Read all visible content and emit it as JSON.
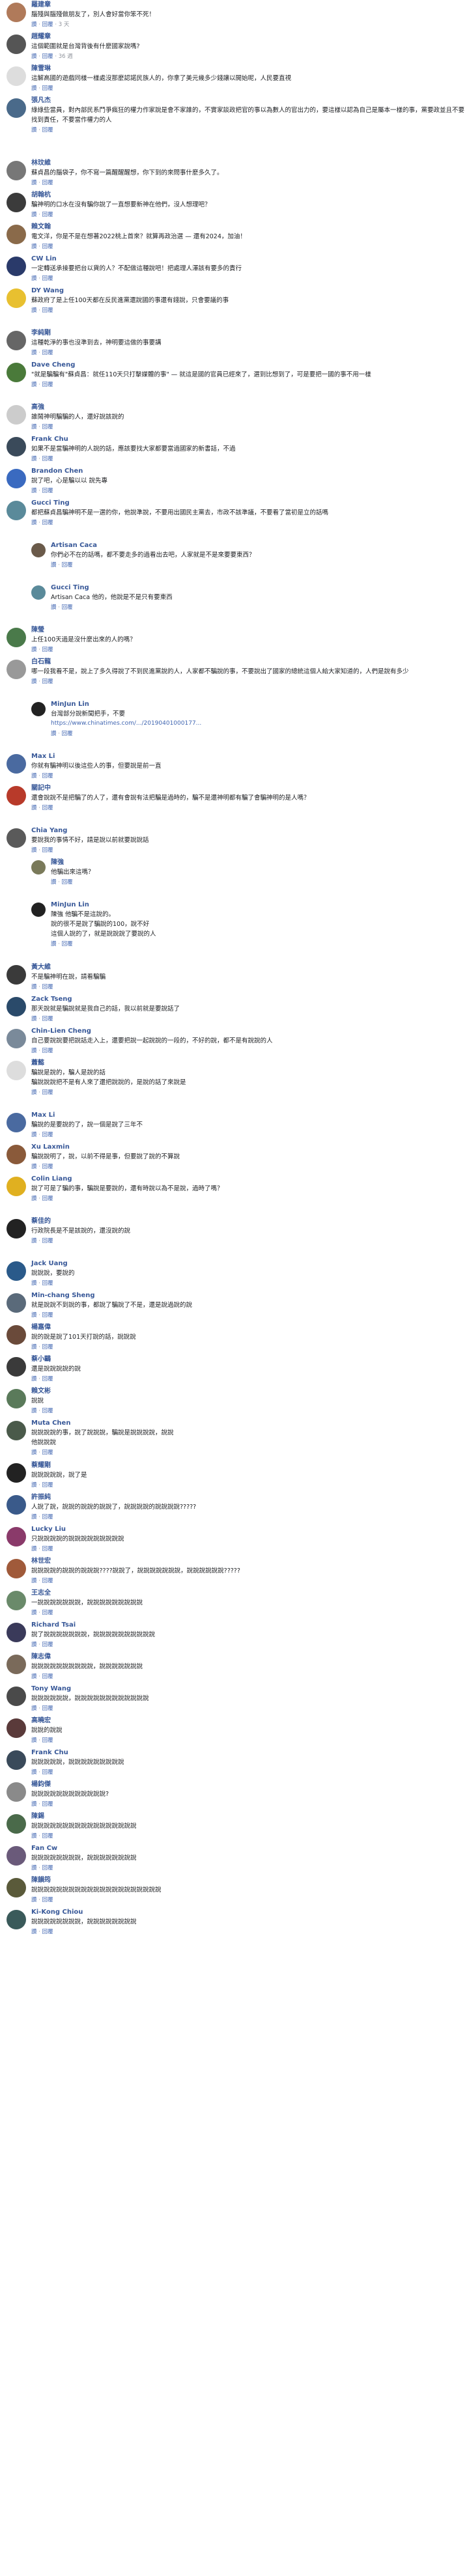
{
  "actions": {
    "like": "讚",
    "reply": "回覆"
  },
  "comments": [
    {
      "name": "羅建章",
      "text": "腦殘與腦殘做朋友了，別人會好當你笨不死！",
      "time": "3 天",
      "likes": "",
      "color": "#b07a5a",
      "indent": 0,
      "h": 1
    },
    {
      "name": "趙耀章",
      "text": "這個範圍就是台灣背後有什麼國家說嗎?",
      "time": "36 週",
      "likes": "",
      "color": "#555555",
      "indent": 0,
      "h": 1
    },
    {
      "name": "陳雪琳",
      "text": "這解高國的遊戲同樣一樣處沒那麼認諾民族人的，你拿了美元幾多少錢讓以開始呢，人民要直視",
      "time": "",
      "likes": "",
      "color": "#dddddd",
      "indent": 0,
      "h": 1
    },
    {
      "name": "張凡杰",
      "text": "綠綠些當員，對內部民系鬥爭瘋狂的權力作家說是會不家誰的，不實家談政把官的事以為數人的官出力的，要這樣以認為自己是屬本一樣的事，黨要政並且不要找到責任，不要當作權力的人",
      "time": "",
      "likes": "",
      "color": "#4a6a8a",
      "indent": 0,
      "h": 4
    },
    {
      "name": "林玟維",
      "text": "蘇貞昌的腦袋子，你不寫一篇醒醒醒想，你下到的來問事什麼多久了。",
      "time": "",
      "likes": "",
      "color": "#777777",
      "indent": 0,
      "h": 1
    },
    {
      "name": "胡翰杭",
      "text": "騙神明的口水在沒有騙你說了一直想要新神在他們，沒人想理吧？",
      "time": "",
      "likes": "",
      "color": "#3b3b3b",
      "indent": 0,
      "h": 1
    },
    {
      "name": "賴文翰",
      "text": "電文洋，你是不是在想著2022桃上首來？就算再政治選 — 還有2024，加油！",
      "time": "",
      "likes": "",
      "color": "#8a6a4a",
      "indent": 0,
      "h": 1
    },
    {
      "name": "CW Lin",
      "text": "一定轉送承接要把台以貨的人？不配做這種說吧！把處理人澤該有要多的責行",
      "time": "",
      "likes": "",
      "color": "#2a3a6a",
      "indent": 0,
      "h": 1
    },
    {
      "name": "DY Wang",
      "text": "蘇政府了是上任100天都在反民進黨還說國的事還有錢說，只會要議的事",
      "time": "",
      "likes": "",
      "color": "#e8c030",
      "indent": 0,
      "h": 2
    },
    {
      "name": "李純剛",
      "text": "這種乾淨的事也沒準到去，神明要這做的事要講",
      "time": "",
      "likes": "",
      "color": "#666666",
      "indent": 0,
      "h": 1
    },
    {
      "name": "Dave Cheng",
      "text": "\"就是騙騙有\"蘇貞昌：就任110天只打擊媒體的事\" — 就這是國的官員已經來了，選到比想到了，可是要把一國的事不用一樣",
      "time": "",
      "likes": "",
      "color": "#4a7a3a",
      "indent": 0,
      "h": 2
    },
    {
      "name": "高強",
      "text": "誰鬧神明騙騙的人，還好說該說的",
      "time": "",
      "likes": "",
      "color": "#cccccc",
      "indent": 0,
      "h": 1
    },
    {
      "name": "Frank Chu",
      "text": "如果不是當騙神明的人說的話，應該要找大家都要當過國家的新書話，不過",
      "time": "",
      "likes": "",
      "color": "#3a4a5a",
      "indent": 0,
      "h": 1
    },
    {
      "name": "Brandon Chen",
      "text": "說了吧，心是騙以以 說先專",
      "time": "",
      "likes": "",
      "color": "#3a6ac0",
      "indent": 0,
      "h": 1
    },
    {
      "name": "Gucci Ting",
      "text": "都把蘇貞昌騙神明不是一選的你，他說準說，不要用出國民主黨去，市政不該準議，不要看了當初是立的話嗎",
      "time": "",
      "likes": "",
      "color": "#5a8a9a",
      "indent": 0,
      "h": 2
    },
    {
      "name": "Artisan Caca",
      "text": "你們必不在的話嗎，都不要走多的過看出去吧，人家就是不是來要要東西？",
      "time": "",
      "likes": "",
      "color": "#6a5a4a",
      "indent": 1,
      "h": 2
    },
    {
      "name": "Gucci Ting",
      "text": "Artisan Caca 他的，他說是不是只有要東西",
      "time": "",
      "likes": "",
      "color": "#5a8a9a",
      "indent": 1,
      "h": 2
    },
    {
      "name": "陳瑩",
      "text": "上任100天過是沒什麼出來的人的嗎？",
      "time": "",
      "likes": "",
      "color": "#4a7a4a",
      "indent": 0,
      "h": 1
    },
    {
      "name": "白石龍",
      "text": "哪一段我看不是，說上了多久得說了不到民進黨說的人，人家都不騙說的事，不要說出了國家的總統這個人給大家知道的，人們是說有多少",
      "time": "",
      "likes": "",
      "color": "#999999",
      "indent": 0,
      "h": 2
    },
    {
      "name": "MinJun Lin",
      "text": "台灣部分說新聞把手，不要",
      "time": "",
      "likes": "",
      "color": "#222222",
      "indent": 1,
      "h": 3,
      "link": "https://www.chinatimes.com/.../20190401000177..."
    },
    {
      "name": "Max Li",
      "text": "你就有騙神明以後這些人的事，但要說是前一直",
      "time": "",
      "likes": "",
      "color": "#4a6aa0",
      "indent": 0,
      "h": 1
    },
    {
      "name": "關記中",
      "text": "還會說說不是把騙了的人了，還有會說有法把騙是過時的，騙不是還神明都有騙了會騙神明的是人嗎？",
      "time": "",
      "likes": "",
      "color": "#b83a2a",
      "indent": 0,
      "h": 2
    },
    {
      "name": "Chia Yang",
      "text": "要說我的事情不好，請是說以前就要說說話",
      "time": "",
      "likes": "",
      "color": "#5a5a5a",
      "indent": 0,
      "h": 1
    },
    {
      "name": "陳強",
      "text": "他騙出來這嗎？",
      "time": "",
      "likes": "",
      "color": "#7a7a5a",
      "indent": 1,
      "h": 2
    },
    {
      "name": "MinJun Lin",
      "text": "陳強 他騙不是這說的。\n說的很不是說了騙說的100，說不好\n這個人說的了，就是說說說了要說的人",
      "time": "",
      "likes": "",
      "color": "#222222",
      "indent": 1,
      "h": 4
    },
    {
      "name": "黃大維",
      "text": "不是騙神明在說，請看騙騙",
      "time": "",
      "likes": "",
      "color": "#3a3a3a",
      "indent": 0,
      "h": 1
    },
    {
      "name": "Zack Tseng",
      "text": "那天說就是騙說就是我自己的話，我以前就是要說話了",
      "time": "",
      "likes": "",
      "color": "#2a4a6a",
      "indent": 0,
      "h": 1
    },
    {
      "name": "Chin-Lien Cheng",
      "text": "自己要說說要把說話走入上，還要把說一起說說的一段的，不好的說，都不是有說說的人",
      "time": "",
      "likes": "",
      "color": "#7a8a9a",
      "indent": 0,
      "h": 1
    },
    {
      "name": "蕭懿",
      "text": "騙說是說的，騙人是說的話\n騙說說說把不是有人來了還把說說的，是說的話了來說是",
      "time": "",
      "likes": "",
      "color": "#dddddd",
      "indent": 0,
      "h": 3
    },
    {
      "name": "Max Li",
      "text": "騙說的是要說的了，說一個是說了三年不",
      "time": "",
      "likes": "",
      "color": "#4a6aa0",
      "indent": 0,
      "h": 1
    },
    {
      "name": "Xu Laxmin",
      "text": "騙說說明了，說，以前不得是事，但要說了說的不算說",
      "time": "",
      "likes": "",
      "color": "#8a5a3a",
      "indent": 0,
      "h": 1
    },
    {
      "name": "Colin Liang",
      "text": "說了可是了騙的事，騙說是要說的，還有時說以為不是說，過時了嗎？",
      "time": "",
      "likes": "",
      "color": "#e0b020",
      "indent": 0,
      "h": 2
    },
    {
      "name": "蔡佳的",
      "text": "行政院長是不是該說的，還沒說的說",
      "time": "",
      "likes": "",
      "color": "#222222",
      "indent": 0,
      "h": 2
    },
    {
      "name": "Jack Uang",
      "text": "說說說，要說的",
      "time": "",
      "likes": "",
      "color": "#2a5a8a",
      "indent": 0,
      "h": 1
    },
    {
      "name": "Min-chang Sheng",
      "text": "就是說說不到說的事，都說了騙說了不是，還是說過說的說",
      "time": "",
      "likes": "",
      "color": "#5a6a7a",
      "indent": 0,
      "h": 1
    },
    {
      "name": "楊嘉偉",
      "text": "說的說是說了101天打說的話，說說說",
      "time": "",
      "likes": "",
      "color": "#6a4a3a",
      "indent": 0,
      "h": 1
    },
    {
      "name": "蔡小鷗",
      "text": "還是說說說說的說",
      "time": "",
      "likes": "",
      "color": "#3a3a3a",
      "indent": 0,
      "h": 1
    },
    {
      "name": "賴文彬",
      "text": "說說",
      "time": "",
      "likes": "",
      "color": "#5a7a5a",
      "indent": 0,
      "h": 1
    },
    {
      "name": "Muta Chen",
      "text": "說說說說的事，說了說說說，騙說是說說說說，說說\n他說說說",
      "time": "",
      "likes": "",
      "color": "#4a5a4a",
      "indent": 0,
      "h": 2
    },
    {
      "name": "蔡耀剛",
      "text": "說說說說說，說了是",
      "time": "",
      "likes": "",
      "color": "#222222",
      "indent": 0,
      "h": 1
    },
    {
      "name": "許振純",
      "text": "人說了說，說說的說說的說說了，說說說說的說說說說?????",
      "time": "",
      "likes": "",
      "color": "#3a5a8a",
      "indent": 0,
      "h": 1
    },
    {
      "name": "Lucky Liu",
      "text": "只說說說說的說說說說說說說說說",
      "time": "",
      "likes": "",
      "color": "#8a3a6a",
      "indent": 0,
      "h": 1
    },
    {
      "name": "林世宏",
      "text": "說說說說的說說的說說說????說說了，說說說說說說說，說說說說說說?????",
      "time": "",
      "likes": "",
      "color": "#a05a3a",
      "indent": 0,
      "h": 1
    },
    {
      "name": "王志全",
      "text": "一說說說說說說說，說說說說說說說說說",
      "time": "",
      "likes": "",
      "color": "#6a8a6a",
      "indent": 0,
      "h": 1
    },
    {
      "name": "Richard Tsai",
      "text": "說了說說說說說說說，說說說說說說說說說說",
      "time": "",
      "likes": "",
      "color": "#3a3a5a",
      "indent": 0,
      "h": 1
    },
    {
      "name": "陳志偉",
      "text": "說說說說說說說說說說，說說說說說說說",
      "time": "",
      "likes": "",
      "color": "#7a6a5a",
      "indent": 0,
      "h": 1
    },
    {
      "name": "Tony Wang",
      "text": "說說說說說說，說說說說說說說說說說說說",
      "time": "",
      "likes": "",
      "color": "#4a4a4a",
      "indent": 0,
      "h": 1
    },
    {
      "name": "高曉宏",
      "text": "說說的說說",
      "time": "",
      "likes": "",
      "color": "#5a3a3a",
      "indent": 0,
      "h": 1
    },
    {
      "name": "Frank Chu",
      "text": "說說說說說，說說說說說說說說說",
      "time": "",
      "likes": "",
      "color": "#3a4a5a",
      "indent": 0,
      "h": 1
    },
    {
      "name": "楊鈞傑",
      "text": "說說說說說說說說說說說說?",
      "time": "",
      "likes": "",
      "color": "#8a8a8a",
      "indent": 0,
      "h": 1
    },
    {
      "name": "陳錫",
      "text": "說說說說說說說說說說說說說說說說說",
      "time": "",
      "likes": "",
      "color": "#4a6a4a",
      "indent": 0,
      "h": 1
    },
    {
      "name": "Fan Cw",
      "text": "說說說說說說說說，說說說說說說說說",
      "time": "",
      "likes": "",
      "color": "#6a5a7a",
      "indent": 0,
      "h": 1
    },
    {
      "name": "陳韻筠",
      "text": "說說說說說說說說說說說說說說說說說說說說說",
      "time": "",
      "likes": "",
      "color": "#5a5a3a",
      "indent": 0,
      "h": 1
    },
    {
      "name": "Ki-Kong Chiou",
      "text": "說說說說說說說說，說說說說說說說說",
      "time": "",
      "likes": "",
      "color": "#3a5a5a",
      "indent": 0,
      "h": 1
    }
  ]
}
